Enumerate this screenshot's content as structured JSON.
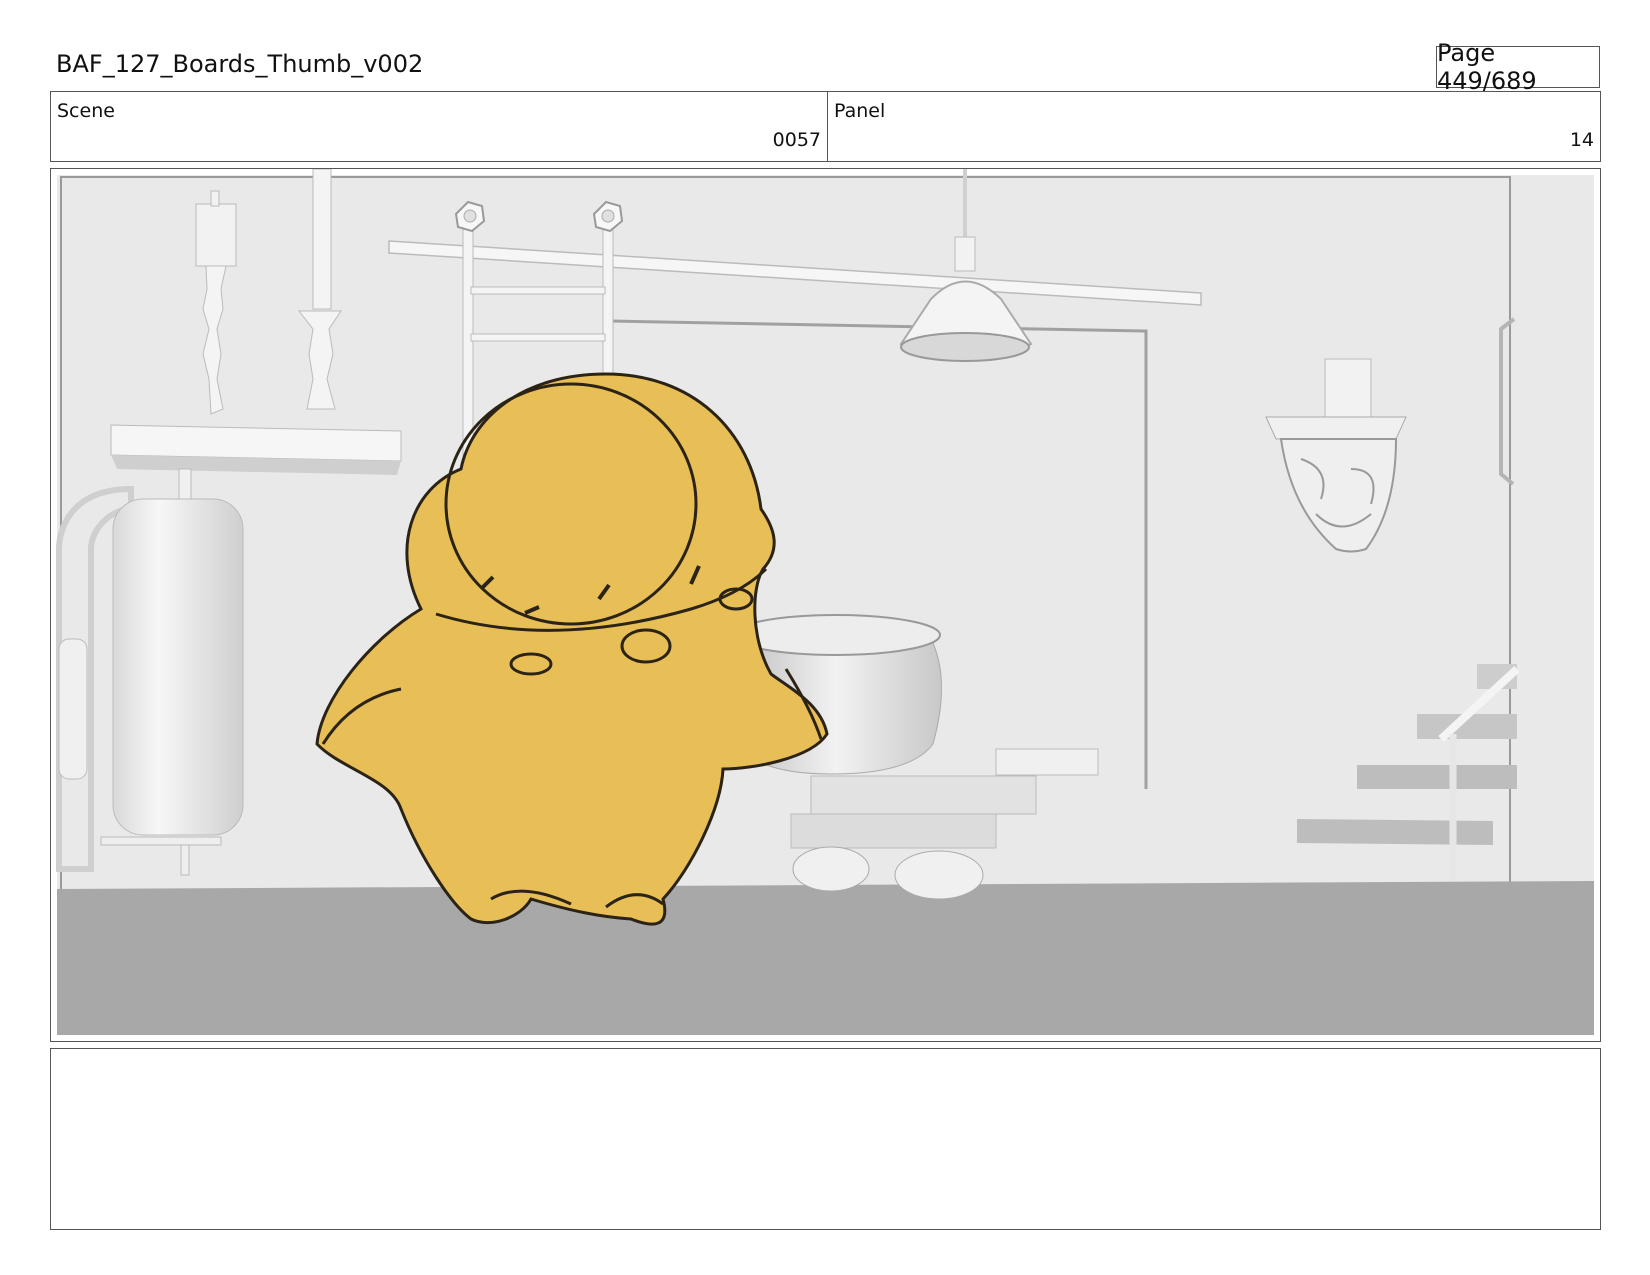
{
  "document": {
    "title": "BAF_127_Boards_Thumb_v002",
    "page_label": "Page 449/689"
  },
  "info": {
    "scene_label": "Scene",
    "scene_value": "0057",
    "panel_label": "Panel",
    "panel_value": "14"
  },
  "colors": {
    "character_fill": "#e8bf57",
    "background_wall": "#e6e6e6",
    "floor": "#a9a9a9",
    "props": "#f2f2f2",
    "border": "#555555"
  },
  "notes": {
    "text": ""
  }
}
